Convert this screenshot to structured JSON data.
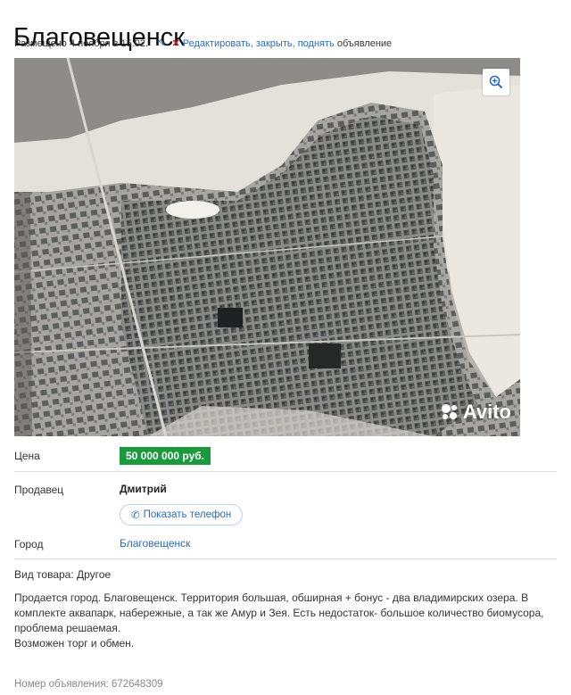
{
  "listing": {
    "title": "Благовещенск",
    "posted": "Размещено 4 ноября в 15:02.",
    "actions_link": "Редактировать, закрыть, поднять",
    "actions_suffix": "объявление",
    "watermark": "Avito"
  },
  "details": {
    "price_label": "Цена",
    "price_value": "50 000 000 руб.",
    "seller_label": "Продавец",
    "seller_name": "Дмитрий",
    "phone_button": "Показать телефон",
    "city_label": "Город",
    "city_value": "Благовещенск"
  },
  "description": {
    "item_type": "Вид товара: Другое",
    "paragraph1": "Продается город. Благовещенск. Территория большая, обширная + бонус - два владимирских озера. В комплекте аквапарк, набережные, а так же Амур и Зея. Есть недостаток- большое количество биомусора, проблема решаемая.",
    "paragraph2": "Возможен торг и обмен."
  },
  "footer": {
    "ad_number": "Номер объявления: 672648309"
  },
  "colors": {
    "price_badge": "#1a9a3c",
    "link": "#2b6bbf",
    "delete_icon": "#d42020"
  },
  "icons": [
    "pin-icon",
    "close-icon",
    "zoom-icon",
    "phone-icon",
    "avito-logo-icon"
  ]
}
